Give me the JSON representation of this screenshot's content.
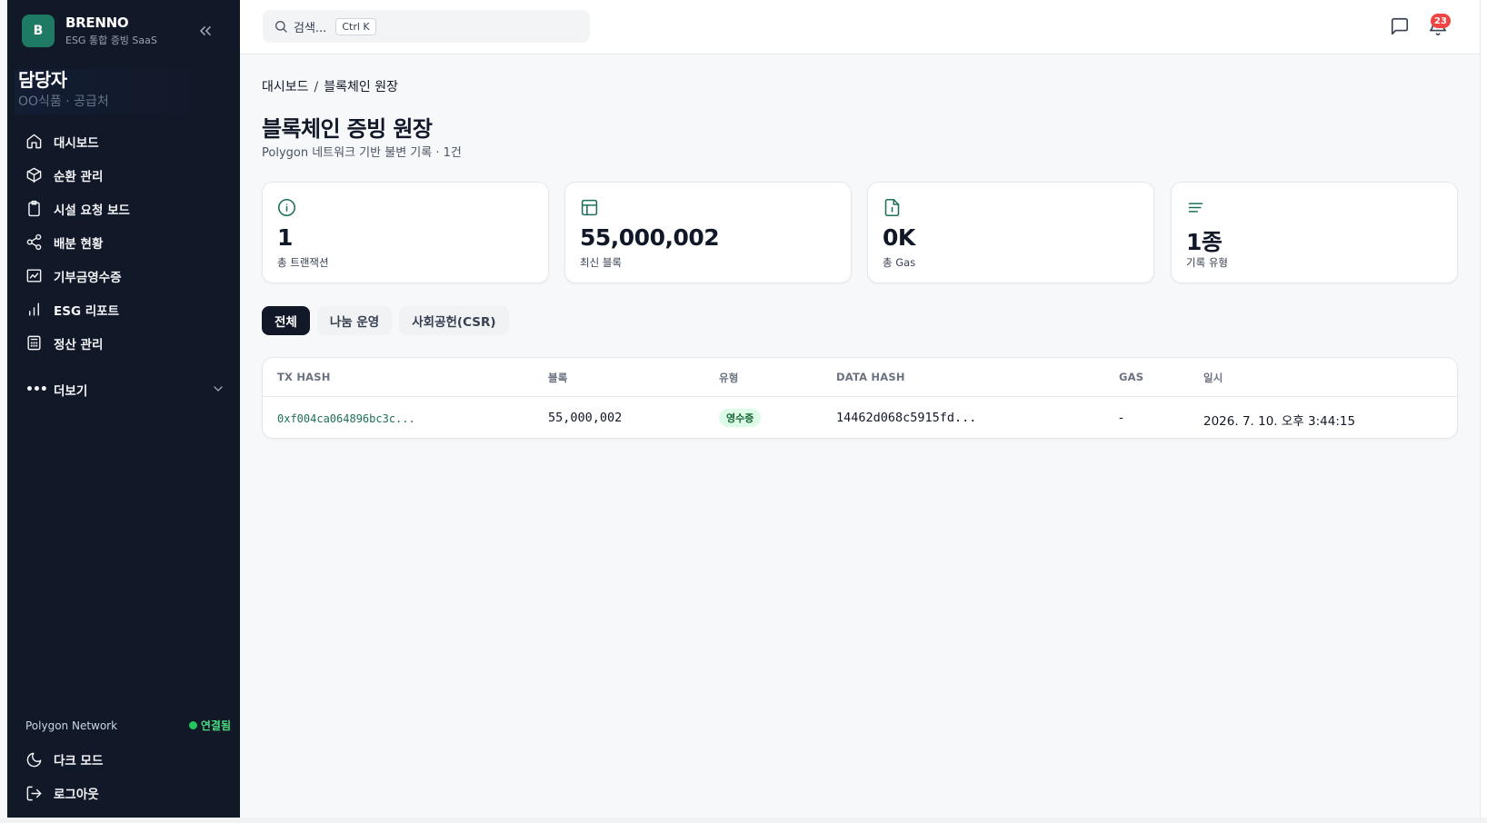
{
  "brand": {
    "logo_letter": "B",
    "name": "BRENNO",
    "subtitle": "ESG 통합 증빙 SaaS"
  },
  "user": {
    "role": "담당자",
    "org": "OO식품 · 공급처"
  },
  "sidebar": {
    "items": [
      {
        "label": "대시보드",
        "icon": "home-icon"
      },
      {
        "label": "순환 관리",
        "icon": "box-icon"
      },
      {
        "label": "시설 요청 보드",
        "icon": "clipboard-icon"
      },
      {
        "label": "배분 현황",
        "icon": "share-icon"
      },
      {
        "label": "기부금영수증",
        "icon": "receipt-icon"
      },
      {
        "label": "ESG 리포트",
        "icon": "bar-chart-icon"
      },
      {
        "label": "정산 관리",
        "icon": "calculator-icon"
      }
    ],
    "more_label": "더보기",
    "network_name": "Polygon Network",
    "network_status": "연결됨",
    "dark_mode_label": "다크 모드",
    "logout_label": "로그아웃"
  },
  "topbar": {
    "search_placeholder": "검색...",
    "shortcut": "Ctrl K",
    "notification_count": "23"
  },
  "page": {
    "breadcrumb_root": "대시보드",
    "breadcrumb_sep": "/",
    "breadcrumb_current": "블록체인 원장",
    "title": "블록체인 증빙 원장",
    "subtitle": "Polygon 네트워크 기반 불변 기록 · 1건"
  },
  "stats": [
    {
      "value": "1",
      "label": "총 트랜잭션",
      "icon": "info-icon"
    },
    {
      "value": "55,000,002",
      "label": "최신 블록",
      "icon": "layout-icon"
    },
    {
      "value": "0K",
      "label": "총 Gas",
      "icon": "file-icon"
    },
    {
      "value": "1종",
      "label": "기록 유형",
      "icon": "list-icon"
    }
  ],
  "tabs": [
    {
      "label": "전체",
      "active": true
    },
    {
      "label": "나눔 운영",
      "active": false
    },
    {
      "label": "사회공헌(CSR)",
      "active": false
    }
  ],
  "table": {
    "headers": [
      "TX HASH",
      "블록",
      "유형",
      "DATA HASH",
      "GAS",
      "일시"
    ],
    "rows": [
      {
        "tx_hash": "0xf004ca064896bc3c...",
        "block": "55,000,002",
        "type": "영수증",
        "data_hash": "14462d068c5915fd...",
        "gas": "-",
        "datetime": "2026. 7. 10. 오후 3:44:15"
      }
    ]
  },
  "colors": {
    "sidebar_bg": "#111827",
    "accent": "#1f7a63",
    "badge": "#ef4444",
    "status_ok": "#22c55e"
  }
}
